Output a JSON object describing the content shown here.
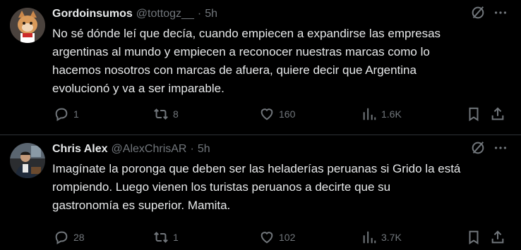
{
  "tweets": [
    {
      "author_name": "Gordoinsumos",
      "handle": "@tottogz__",
      "separator": "·",
      "time": "5h",
      "text": "No sé dónde leí que decía, cuando empiecen a expandirse las empresas\nargentinas al mundo y empiecen a reconocer nuestras marcas como lo\nhacemos nosotros con marcas de afuera, quiere decir que Argentina\nevolucionó y va a ser imparable.",
      "replies": "1",
      "reposts": "8",
      "likes": "160",
      "views": "1.6K"
    },
    {
      "author_name": "Chris Alex",
      "handle": "@AlexChrisAR",
      "separator": "·",
      "time": "5h",
      "text": "Imagínate la poronga que deben ser las heladerías peruanas si Grido la está\nrompiendo. Luego vienen los turistas peruanos a decirte que su\ngastronomía es superior. Mamita.",
      "replies": "28",
      "reposts": "1",
      "likes": "102",
      "views": "3.7K"
    }
  ],
  "icons": {
    "grok": "grok-icon",
    "more": "more-icon",
    "reply": "reply-icon",
    "repost": "repost-icon",
    "like": "heart-icon",
    "views": "views-icon",
    "bookmark": "bookmark-icon",
    "share": "share-icon"
  },
  "colors": {
    "background": "#000000",
    "text": "#e7e9ea",
    "muted": "#71767b",
    "divider": "#2f3336"
  }
}
